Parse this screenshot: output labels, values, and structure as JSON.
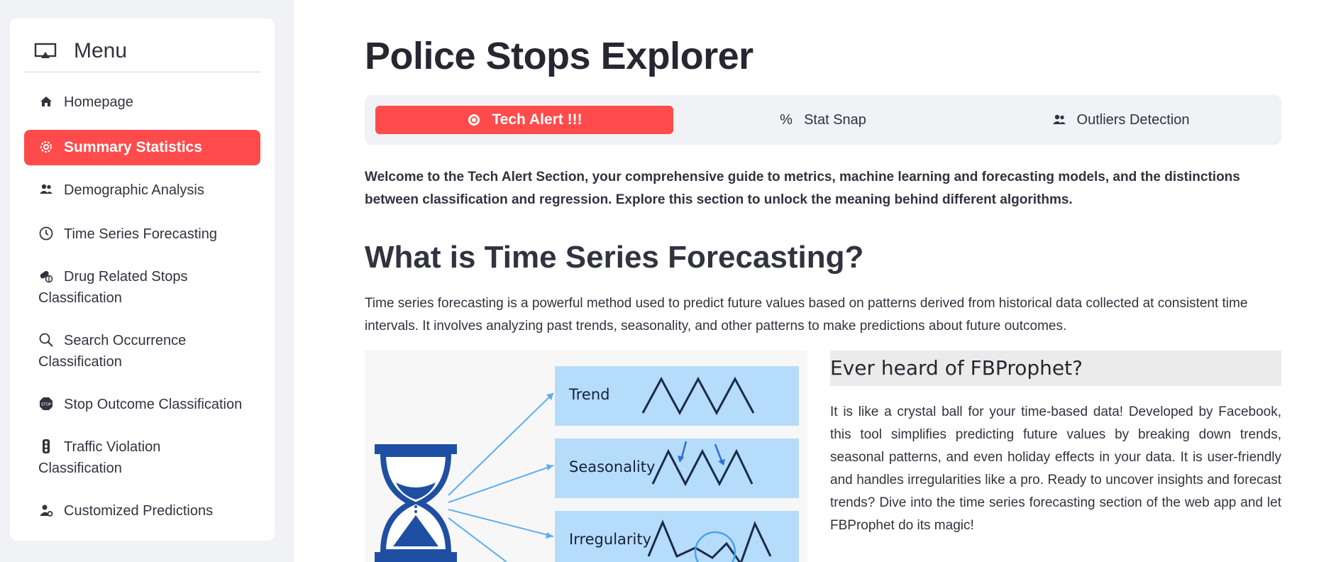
{
  "sidebar": {
    "menu_title": "Menu",
    "items": [
      {
        "label": "Homepage",
        "icon": "house-icon"
      },
      {
        "label": "Summary Statistics",
        "icon": "gear-icon",
        "active": true
      },
      {
        "label": "Demographic Analysis",
        "icon": "people-icon"
      },
      {
        "label": "Time Series Forecasting",
        "icon": "clock-icon"
      },
      {
        "label": "Drug Related Stops Classification",
        "icon": "capsule-icon"
      },
      {
        "label": "Search Occurrence Classification",
        "icon": "search-icon"
      },
      {
        "label": "Stop Outcome Classification",
        "icon": "stop-sign-icon"
      },
      {
        "label": "Traffic Violation Classification",
        "icon": "traffic-light-icon"
      },
      {
        "label": "Customized Predictions",
        "icon": "person-gear-icon"
      }
    ]
  },
  "main": {
    "title": "Police Stops Explorer",
    "tabs": [
      {
        "label": "Tech Alert !!!",
        "icon": "cpu-icon",
        "active": true
      },
      {
        "label": "Stat Snap",
        "icon": "percent-icon"
      },
      {
        "label": "Outliers Detection",
        "icon": "people-icon"
      }
    ],
    "intro": "Welcome to the Tech Alert Section, your comprehensive guide to metrics, machine learning and forecasting models, and the distinctions between classification and regression. Explore this section to unlock the meaning behind different algorithms.",
    "section_title": "What is Time Series Forecasting?",
    "section_text": "Time series forecasting is a powerful method used to predict future values based on patterns derived from historical data collected at consistent time intervals. It involves analyzing past trends, seasonality, and other patterns to make predictions about future outcomes.",
    "figure": {
      "labels": [
        "Trend",
        "Seasonality",
        "Irregularity"
      ]
    },
    "side_heading": "Ever heard of FBProphet?",
    "side_text": "It is like a crystal ball for your time-based data! Developed by Facebook, this tool simplifies predicting future values by breaking down trends, seasonal patterns, and even holiday effects in your data. It is user-friendly and handles irregularities like a pro. Ready to uncover insights and forecast trends? Dive into the time series forecasting section of the web app and let FBProphet do its magic!"
  },
  "colors": {
    "accent": "#ff4b4b",
    "sidebar_bg": "#f0f2f6",
    "figure_box": "#b5dcfb",
    "hourglass": "#1f4fa3"
  }
}
